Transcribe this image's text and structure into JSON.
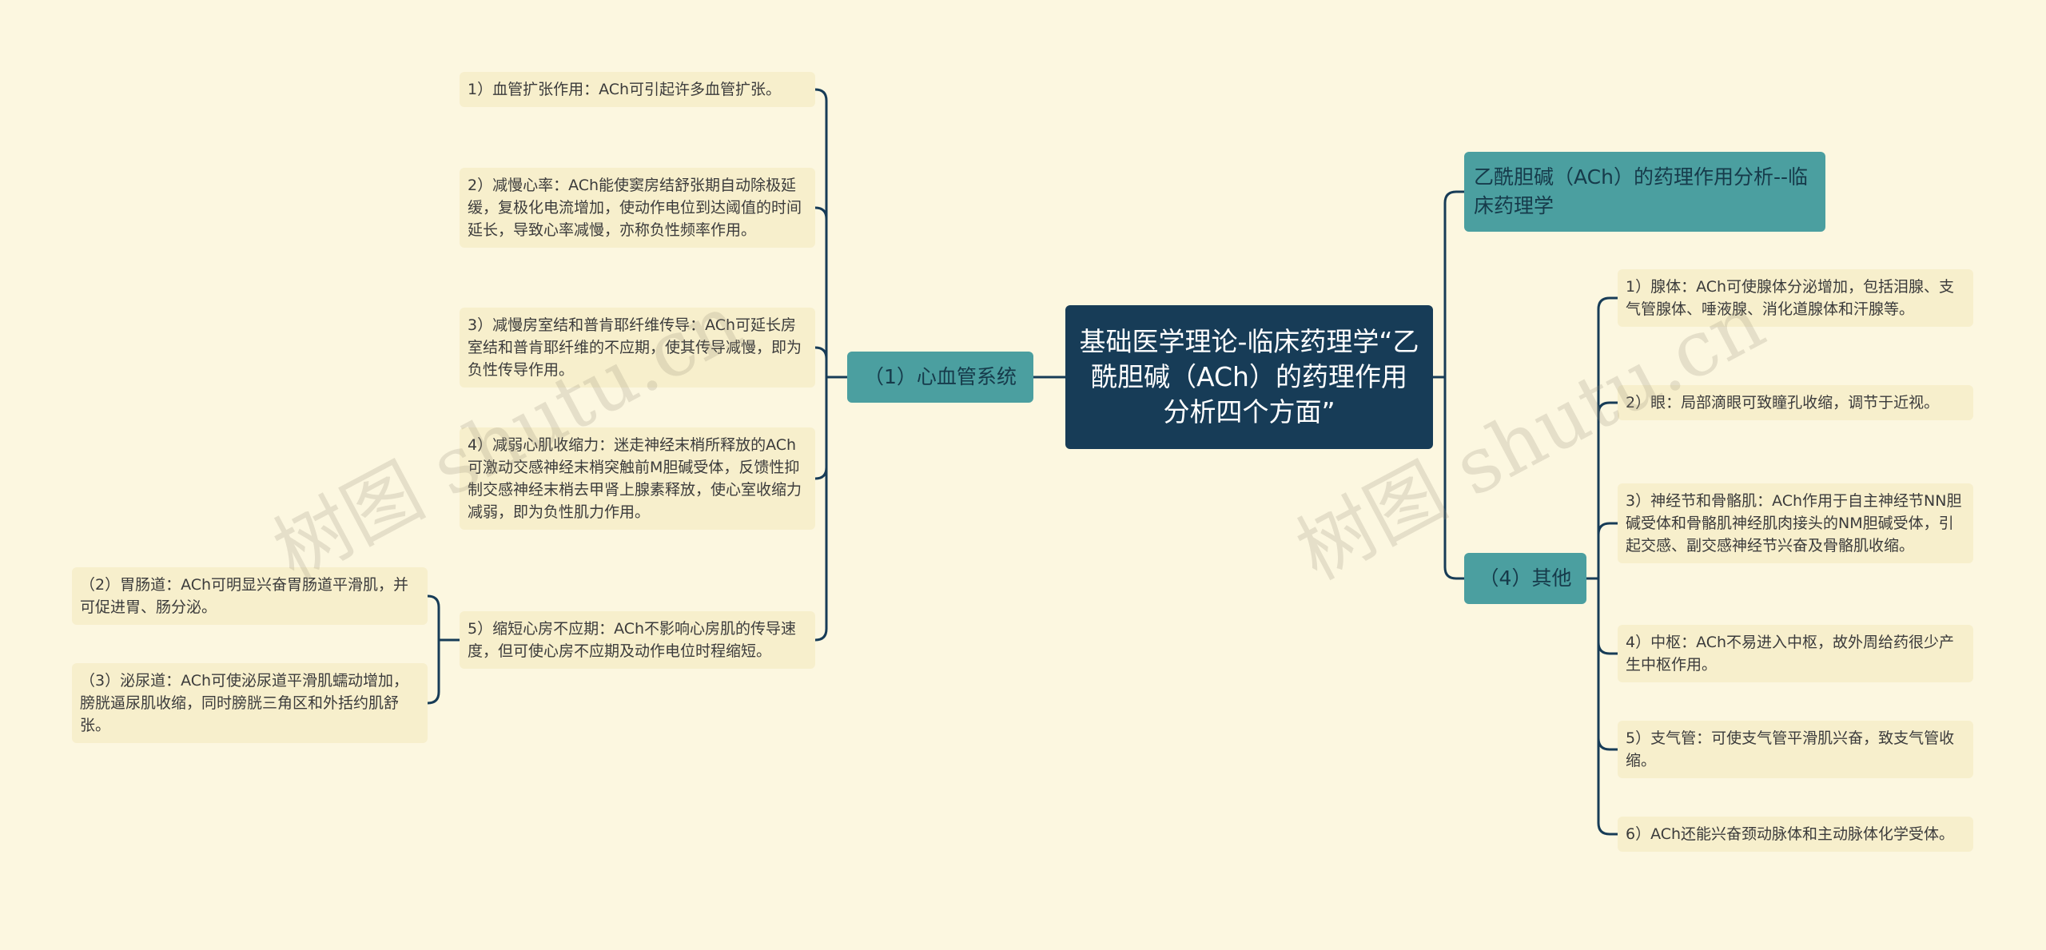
{
  "root": {
    "text": "基础医学理论-临床药理学“乙酰胆碱（ACh）的药理作用分析四个方面”"
  },
  "left_branch": {
    "label": "（1）心血管系统",
    "items": [
      "1）血管扩张作用：ACh可引起许多血管扩张。",
      "2）减慢心率：ACh能使窦房结舒张期自动除极延缓，复极化电流增加，使动作电位到达阈值的时间延长，导致心率减慢，亦称负性频率作用。",
      "3）减慢房室结和普肯耶纤维传导：ACh可延长房室结和普肯耶纤维的不应期，使其传导减慢，即为负性传导作用。",
      "4）减弱心肌收缩力：迷走神经末梢所释放的ACh可激动交感神经末梢突触前M胆碱受体，反馈性抑制交感神经末梢去甲肾上腺素释放，使心室收缩力减弱，即为负性肌力作用。",
      "5）缩短心房不应期：ACh不影响心房肌的传导速度，但可使心房不应期及动作电位时程缩短。"
    ],
    "sub_items": [
      "（2）胃肠道：ACh可明显兴奋胃肠道平滑肌，并可促进胃、肠分泌。",
      "（3）泌尿道：ACh可使泌尿道平滑肌蠕动增加，膀胱逼尿肌收缩，同时膀胱三角区和外括约肌舒张。"
    ]
  },
  "right_title": {
    "label": "乙酰胆碱（ACh）的药理作用分析--临床药理学"
  },
  "right_branch": {
    "label": "（4）其他",
    "items": [
      "1）腺体：ACh可使腺体分泌增加，包括泪腺、支气管腺体、唾液腺、消化道腺体和汗腺等。",
      "2）眼：局部滴眼可致瞳孔收缩，调节于近视。",
      "3）神经节和骨骼肌：ACh作用于自主神经节NN胆碱受体和骨骼肌神经肌肉接头的NM胆碱受体，引起交感、副交感神经节兴奋及骨骼肌收缩。",
      "4）中枢：ACh不易进入中枢，故外周给药很少产生中枢作用。",
      "5）支气管：可使支气管平滑肌兴奋，致支气管收缩。",
      "6）ACh还能兴奋颈动脉体和主动脉体化学受体。"
    ]
  },
  "watermarks": [
    "树图 shutu.cn",
    "树图 shutu.cn"
  ],
  "colors": {
    "background": "#fcf7e0",
    "root": "#173c57",
    "branch": "#4b9fa0",
    "leaf": "#f7efcc",
    "connector": "#173c57"
  }
}
